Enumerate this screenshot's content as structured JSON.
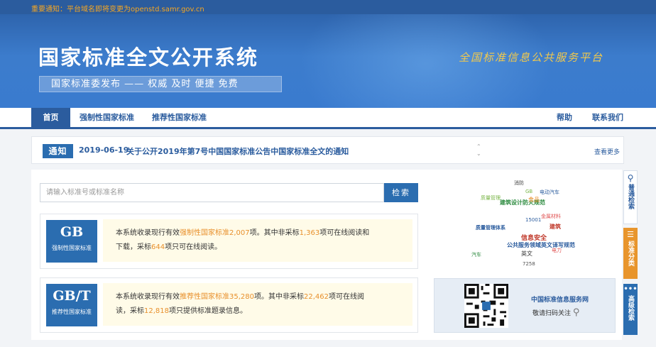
{
  "top_notice": "重要通知：平台域名即将变更为openstd.samr.gov.cn",
  "banner": {
    "title": "国家标准全文公开系统",
    "subtitle": "国家标准委发布 —— 权威 及时 便捷 免费",
    "right_slogan": "全国标准信息公共服务平台"
  },
  "nav": {
    "items": [
      "首页",
      "强制性国家标准",
      "推荐性国家标准"
    ],
    "right": [
      "帮助",
      "联系我们"
    ]
  },
  "notice": {
    "tag": "通知",
    "date": "2019-06-19",
    "text": "关于公开2019年第7号中国国家标准公告中国家标准全文的通知",
    "more": "查看更多"
  },
  "search": {
    "placeholder": "请输入标准号或标准名称",
    "button": "检索"
  },
  "gb": {
    "code": "GB",
    "label": "强制性国家标准",
    "text_1": "本系统收录现行有效",
    "hl_1": "强制性国家标准2,007",
    "text_2": "项。其中非采标",
    "hl_2": "1,363",
    "text_3": "项可在线阅读和",
    "line2_a": "下载，采标",
    "hl_3": "644",
    "line2_b": "项只可在线阅读。"
  },
  "gbt": {
    "code": "GB/T",
    "label": "推荐性国家标准",
    "text_1": "本系统收录现行有效",
    "hl_1": "推荐性国家标准35,280",
    "text_2": "项。其中非采标",
    "hl_2": "22,462",
    "text_3": "项可在线阅",
    "line2_a": "读，采标",
    "hl_3": "12,818",
    "line2_b": "项只提供标准题录信息。"
  },
  "word_cloud": [
    {
      "text": "消防",
      "color": "#444444"
    },
    {
      "text": "GB",
      "color": "#7ab648"
    },
    {
      "text": "电动汽车",
      "color": "#2b5c9e"
    },
    {
      "text": "质量管理",
      "color": "#7ab648"
    },
    {
      "text": "建筑设计防火规范",
      "color": "#2b8a3e"
    },
    {
      "text": "食品",
      "color": "#e8902c"
    },
    {
      "text": "金属材料",
      "color": "#e05252"
    },
    {
      "text": "15001",
      "color": "#2b5c9e"
    },
    {
      "text": "质量管理体系",
      "color": "#2b5c9e"
    },
    {
      "text": "建筑",
      "color": "#c0392b"
    },
    {
      "text": "信息安全",
      "color": "#c0392b"
    },
    {
      "text": "公共服务领域英文译写规范",
      "color": "#2b5c9e"
    },
    {
      "text": "电力",
      "color": "#e05252"
    },
    {
      "text": "汽车",
      "color": "#2b8a3e"
    },
    {
      "text": "英文",
      "color": "#333333"
    },
    {
      "text": "7258",
      "color": "#555555"
    }
  ],
  "qr": {
    "title": "中国标准信息服务网",
    "subtitle": "敬请扫码关注"
  },
  "side_tabs": [
    "普通检索",
    "标准分类",
    "高级检索"
  ]
}
